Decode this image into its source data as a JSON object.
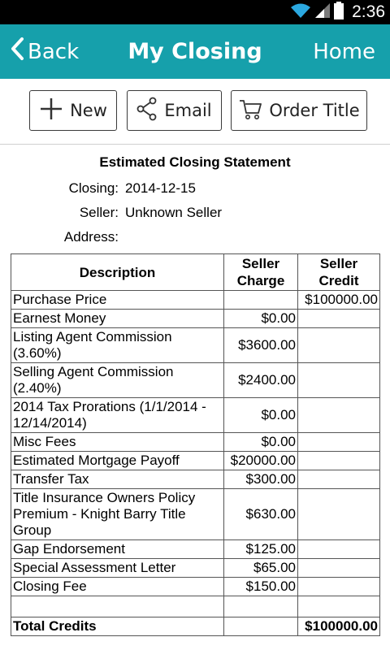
{
  "status": {
    "time": "2:36"
  },
  "nav": {
    "back_label": "Back",
    "title": "My Closing",
    "home_label": "Home",
    "accent": "#16a0ab"
  },
  "toolbar": {
    "new_label": "New",
    "email_label": "Email",
    "order_title_label": "Order Title"
  },
  "statement": {
    "title": "Estimated Closing Statement",
    "closing_label": "Closing:",
    "closing_value": "2014-12-15",
    "seller_label": "Seller:",
    "seller_value": "Unknown Seller",
    "address_label": "Address:",
    "address_value": ""
  },
  "table": {
    "headers": {
      "description": "Description",
      "seller_charge": "Seller Charge",
      "seller_credit": "Seller Credit"
    },
    "rows": [
      {
        "description": "Purchase Price",
        "charge": "",
        "credit": "$100000.00"
      },
      {
        "description": "Earnest Money",
        "charge": "$0.00",
        "credit": ""
      },
      {
        "description": "Listing Agent Commission (3.60%)",
        "charge": "$3600.00",
        "credit": ""
      },
      {
        "description": "Selling Agent Commission (2.40%)",
        "charge": "$2400.00",
        "credit": ""
      },
      {
        "description": "2014 Tax Prorations (1/1/2014 - 12/14/2014)",
        "charge": "$0.00",
        "credit": ""
      },
      {
        "description": "Misc Fees",
        "charge": "$0.00",
        "credit": ""
      },
      {
        "description": "Estimated Mortgage Payoff",
        "charge": "$20000.00",
        "credit": ""
      },
      {
        "description": "Transfer Tax",
        "charge": "$300.00",
        "credit": ""
      },
      {
        "description": "Title Insurance Owners Policy Premium - Knight Barry Title Group",
        "charge": "$630.00",
        "credit": ""
      },
      {
        "description": "Gap Endorsement",
        "charge": "$125.00",
        "credit": ""
      },
      {
        "description": "Special Assessment Letter",
        "charge": "$65.00",
        "credit": ""
      },
      {
        "description": "Closing Fee",
        "charge": "$150.00",
        "credit": ""
      },
      {
        "description": "",
        "charge": "",
        "credit": ""
      }
    ],
    "total": {
      "label": "Total Credits",
      "charge": "",
      "credit": "$100000.00"
    }
  }
}
